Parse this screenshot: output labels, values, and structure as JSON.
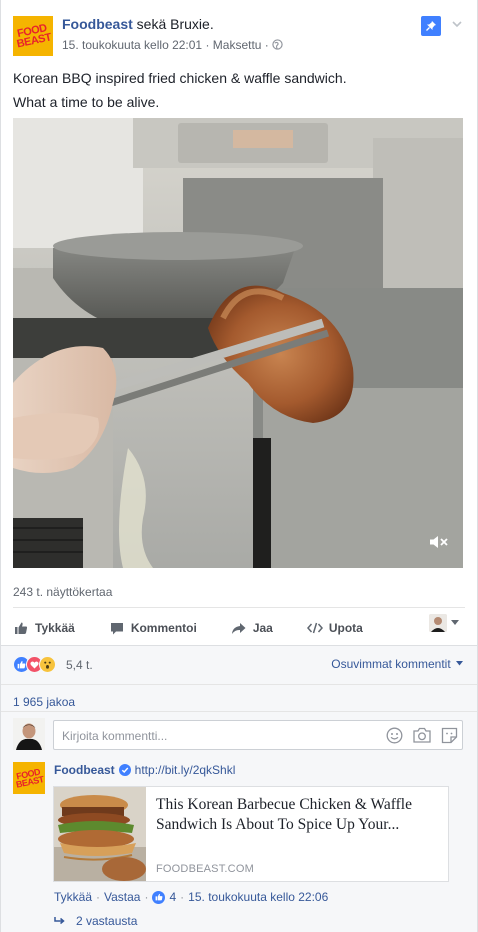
{
  "post": {
    "page_name": "Foodbeast",
    "with_text": "sekä Bruxie.",
    "logo_text": "FOOD BEAST",
    "timestamp": "15. toukokuuta kello 22:01",
    "separator": " · ",
    "sponsored": "Maksettu",
    "text_line1": "Korean BBQ inspired fried chicken & waffle sandwich.",
    "text_line2": "What a time to be alive."
  },
  "video": {
    "views": "243 t. näyttökertaa",
    "mute_icon": "speaker-muted-icon"
  },
  "actions": {
    "like": "Tykkää",
    "comment": "Kommentoi",
    "share": "Jaa",
    "embed": "Upota"
  },
  "reactions": {
    "types": [
      "like",
      "love",
      "wow"
    ],
    "count": "5,4 t."
  },
  "comments_filter": "Osuvimmat kommentit",
  "shares": "1 965 jakoa",
  "composer": {
    "placeholder": "Kirjoita kommentti..."
  },
  "comment": {
    "author": "Foodbeast",
    "link_text": "http://bit.ly/2qkShkl",
    "card_title": "This Korean Barbecue Chicken & Waffle Sandwich Is About To Spice Up Your...",
    "card_domain": "FOODBEAST.COM",
    "like": "Tykkää",
    "reply": "Vastaa",
    "dot": "·",
    "like_count": "4",
    "timestamp": "15. toukokuuta kello 22:06",
    "replies": "2 vastausta"
  },
  "colors": {
    "link": "#365899",
    "accent": "#4080ff",
    "brand_logo_bg": "#f5b400",
    "brand_logo_text": "#e8222a"
  }
}
